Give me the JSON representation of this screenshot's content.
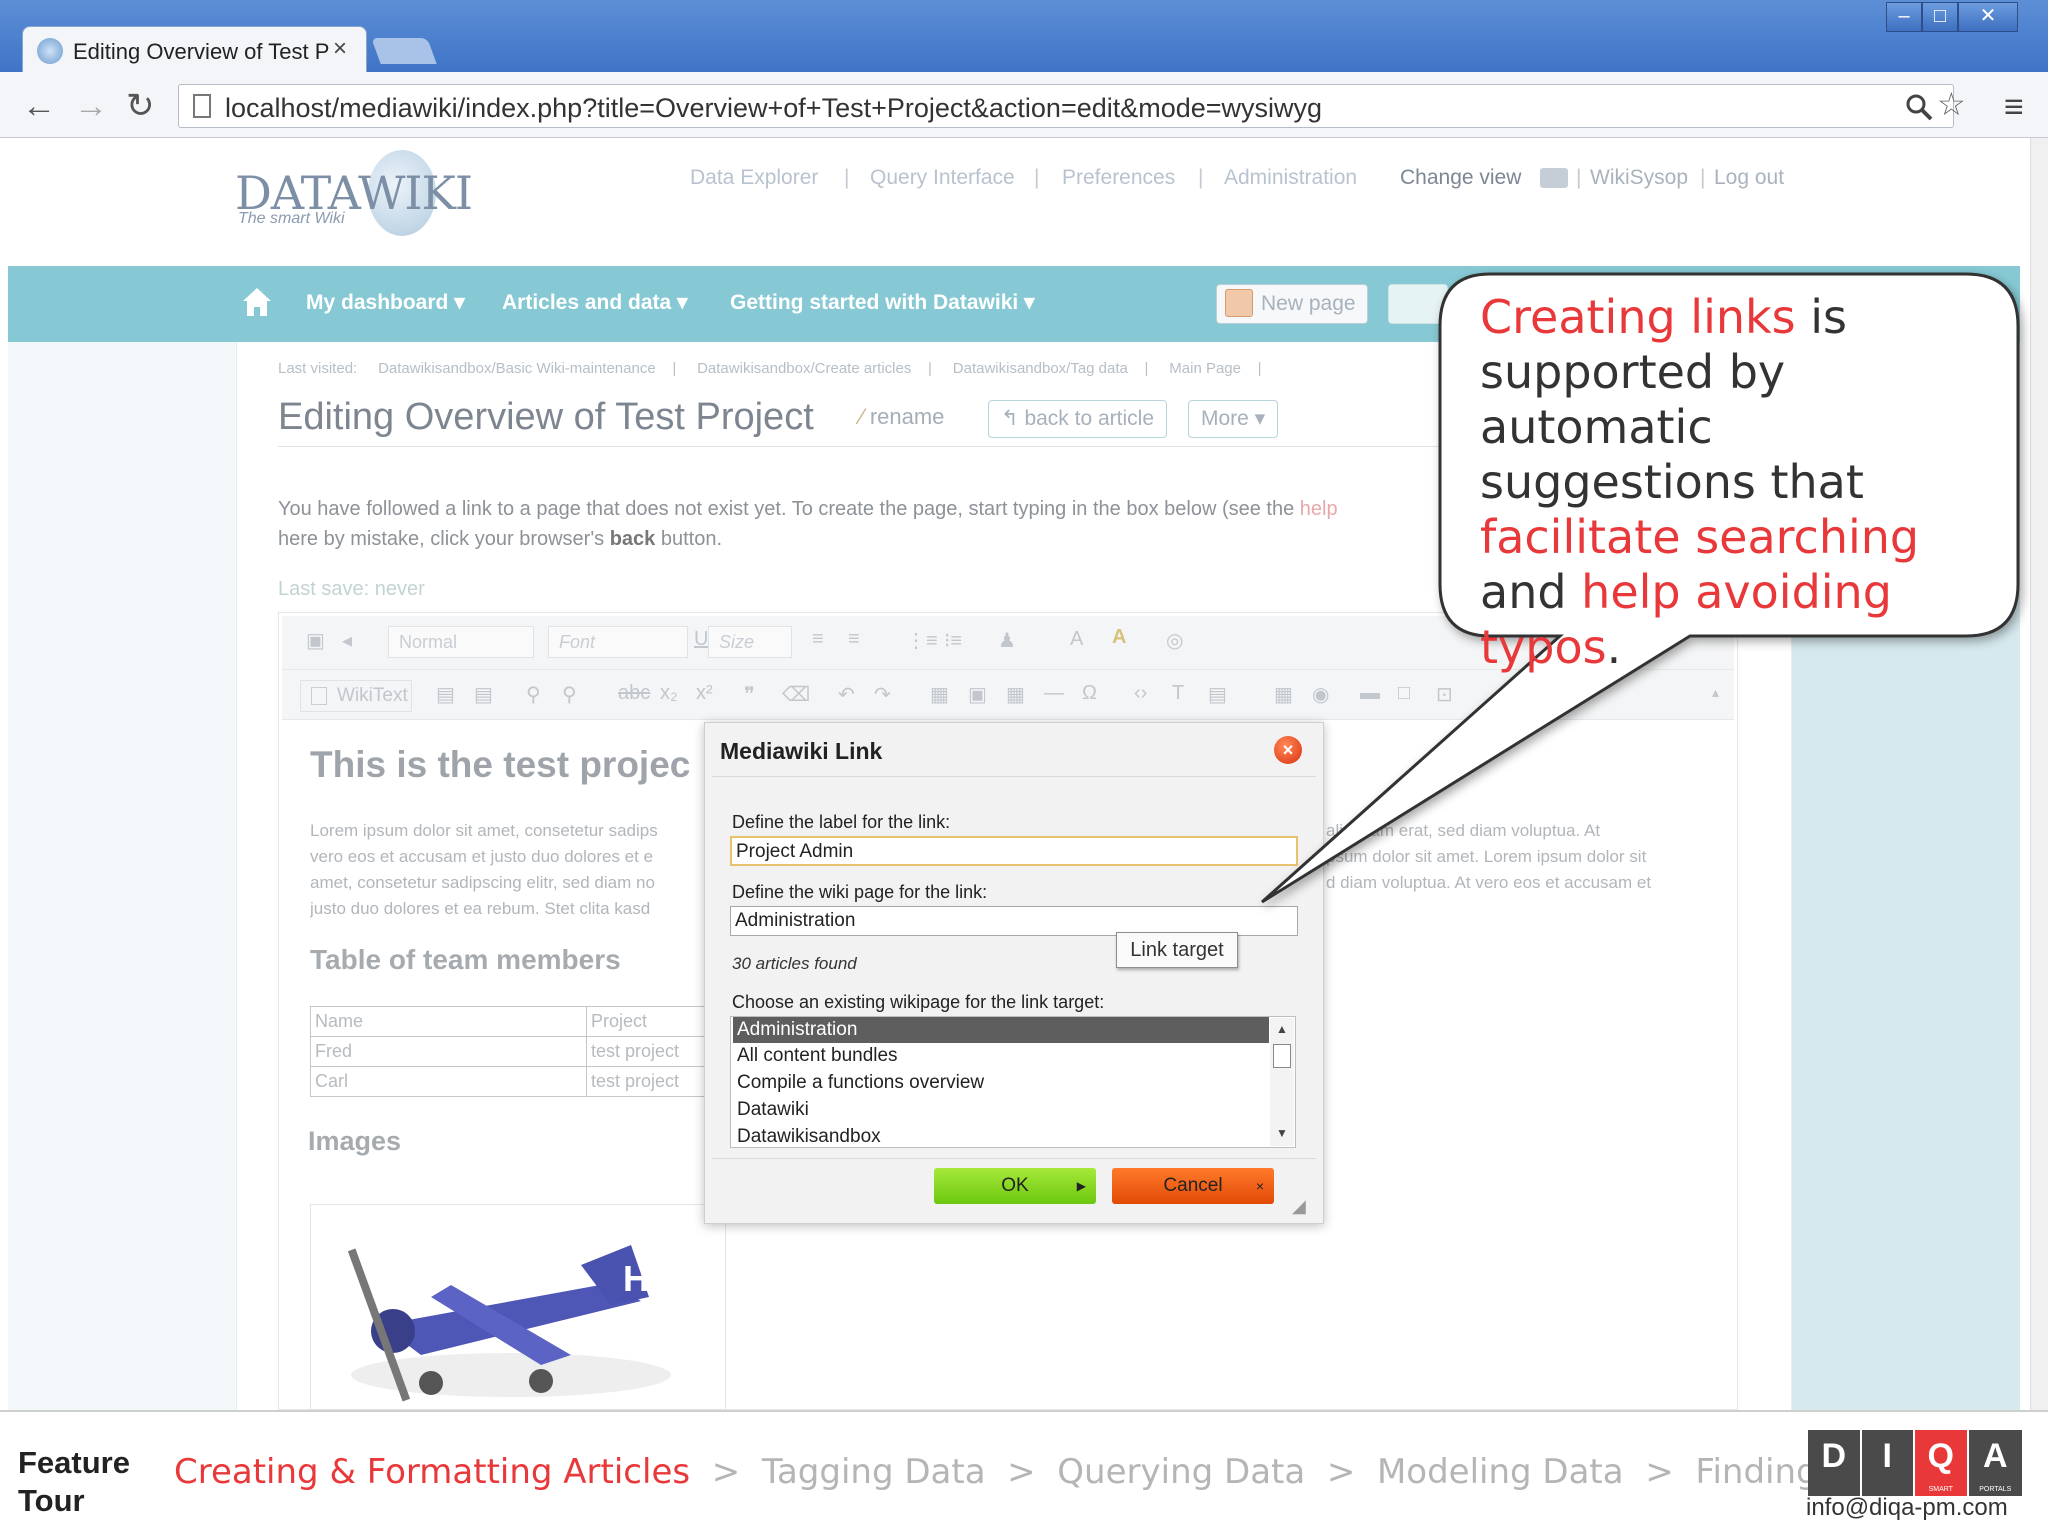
{
  "browser": {
    "tab_title": "Editing Overview of Test P",
    "tab_close": "×",
    "url": "localhost/mediawiki/index.php?title=Overview+of+Test+Project&action=edit&mode=wysiwyg",
    "window_min": "–",
    "window_max": "□",
    "window_close": "✕"
  },
  "site": {
    "logo": "DATAWIKI",
    "logo_tagline": "The smart Wiki",
    "top_links": [
      "Data Explorer",
      "Query Interface",
      "Preferences",
      "Administration"
    ],
    "change_view": "Change view",
    "user": "WikiSysop",
    "logout": "Log out"
  },
  "nav": {
    "items": [
      "My dashboard ▾",
      "Articles and data ▾",
      "Getting started with Datawiki ▾"
    ],
    "new_page": "New page"
  },
  "page": {
    "last_visited_label": "Last visited:",
    "last_visited": [
      "Datawikisandbox/Basic Wiki-maintenance",
      "Datawikisandbox/Create articles",
      "Datawikisandbox/Tag data",
      "Main Page"
    ],
    "title": "Editing Overview of Test Project",
    "rename": "rename",
    "back_to_article": "back to article",
    "more": "More ▾",
    "notice_1": "You have followed a link to a page that does not exist yet. To create the page, start typing in the box below (see the ",
    "notice_help": "help",
    "notice_2": "here by mistake, click your browser's ",
    "notice_back": "back",
    "notice_3": " button.",
    "last_save": "Last save: never"
  },
  "editor": {
    "format_select": "Normal",
    "font_select": "Font",
    "size_select": "Size",
    "wikitext": "WikiText",
    "doc_heading": "This is the test projec",
    "doc_paragraph": "Lorem ipsum dolor sit amet, consetetur sadips|vero eos et accusam et justo duo dolores et e|amet, consetetur sadipscing elitr, sed diam no|justo duo dolores et ea rebum. Stet clita kasd",
    "doc_paragraph_right": "aliquyam erat, sed diam voluptua. At|psum dolor sit amet. Lorem ipsum dolor sit|d diam voluptua. At vero eos et accusam et",
    "table_heading": "Table of team members",
    "table_header": [
      "Name",
      "Project"
    ],
    "table_rows": [
      [
        "Fred",
        "test project"
      ],
      [
        "Carl",
        "test project"
      ]
    ],
    "images_heading": "Images"
  },
  "dialog": {
    "title": "Mediawiki Link",
    "label_prompt": "Define the label for the link:",
    "label_value": "Project Admin",
    "page_prompt": "Define the wiki page for the link:",
    "page_value": "Administration",
    "tooltip": "Link target",
    "found": "30 articles found",
    "choose_prompt": "Choose an existing wikipage for the link target:",
    "options": [
      "Administration",
      "All content bundles",
      "Compile a functions overview",
      "Datawiki",
      "Datawikisandbox"
    ],
    "selected_option": "Administration",
    "ok": "OK",
    "cancel": "Cancel"
  },
  "callout": {
    "t1": "Creating links",
    "t2": " is supported by automatic suggestions that ",
    "t3": "facilitate searching",
    "t4": " and ",
    "t5": "help avoiding typos",
    "t6": "."
  },
  "footer": {
    "label": "Feature Tour",
    "steps": [
      "Creating & Formatting Articles",
      "Tagging Data",
      "Querying Data",
      "Modeling Data",
      "Finding Content"
    ],
    "active_step": "Creating & Formatting Articles",
    "separator": ">",
    "brand_letters": [
      "D",
      "I",
      "Q",
      "A"
    ],
    "brand_sub": [
      "SMART",
      "PORTALS"
    ],
    "email": "info@diqa-pm.com"
  },
  "colors": {
    "accent_red": "#e8383a",
    "nav_teal": "#86c9d4",
    "ok_green": "#7cd01a",
    "cancel_orange": "#ee5a10"
  }
}
